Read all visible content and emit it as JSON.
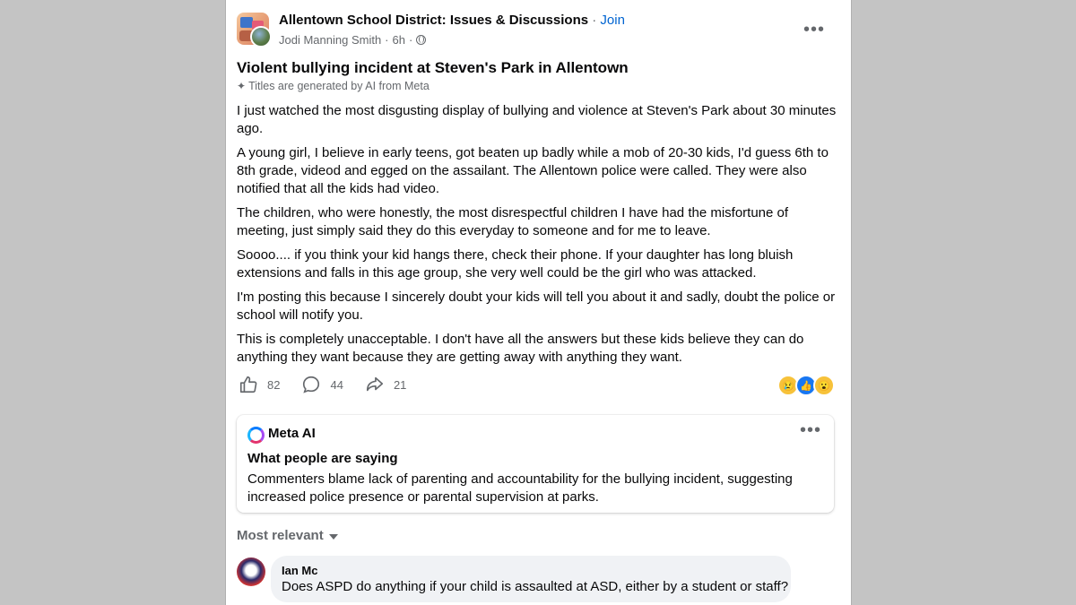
{
  "post": {
    "group_name": "Allentown School District: Issues & Discussions",
    "separator": " · ",
    "join_label": "Join",
    "author": "Jodi Manning Smith",
    "time": "6h",
    "title": "Violent bullying incident at Steven's Park in Allentown",
    "ai_title_note": "Titles are generated by AI from Meta",
    "paragraphs": [
      "I just watched the most disgusting display of bullying and violence at Steven's Park about 30 minutes ago.",
      "A young girl, I believe in early teens, got beaten up badly while a mob of 20-30 kids, I'd guess 6th to 8th grade, videod and egged on the assailant. The Allentown police were called. They were also notified that all the kids had video.",
      "The children, who were honestly, the most disrespectful children I have had the misfortune of meeting, just simply said they do this everyday to someone and for me to leave.",
      "Soooo.... if you think your kid hangs there, check their phone. If your daughter has long bluish extensions and falls in this age group, she very well could be the girl who was attacked.",
      "I'm posting this because I sincerely doubt your kids will tell you about it and sadly, doubt the police or school will notify you.",
      "This is completely unacceptable. I don't have all the answers but these kids believe they can do anything they want because they are getting away with anything they want."
    ],
    "likes": "82",
    "comments": "44",
    "shares": "21",
    "reactions": [
      "sad-reaction-icon",
      "like-reaction-icon",
      "wow-reaction-icon"
    ]
  },
  "meta_ai": {
    "name": "Meta AI",
    "heading": "What people are saying",
    "summary": "Commenters blame lack of parenting and accountability for the bullying incident, suggesting increased police presence or parental supervision at parks."
  },
  "comments": {
    "sort_label": "Most relevant",
    "items": [
      {
        "author": "Ian Mc",
        "text": "Does ASPD do anything if your child is assaulted at ASD, either by a student or staff?"
      }
    ]
  },
  "colors": {
    "background": "#c4c4c4",
    "card": "#ffffff",
    "link": "#0064d1",
    "secondary_text": "#65686c",
    "like_blue": "#1877f2"
  }
}
